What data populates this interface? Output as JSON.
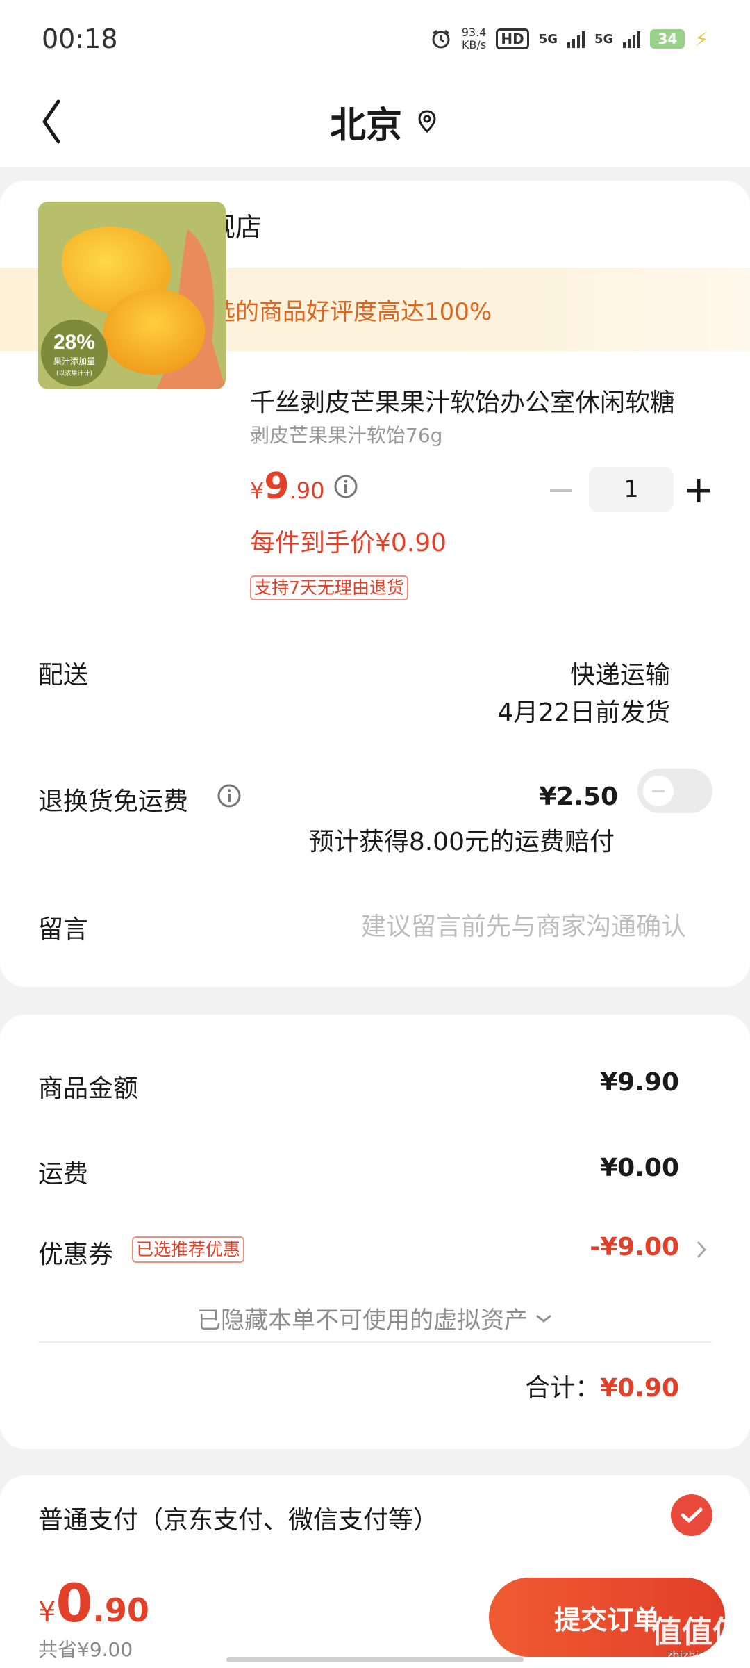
{
  "status_bar": {
    "time": "00:18",
    "net_speed": "93.4",
    "net_unit": "KB/s",
    "hd": "HD",
    "sig1": "5G",
    "sig2": "5G",
    "battery": "34",
    "icons": [
      "alarm-icon",
      "hd-icon",
      "signal-icon",
      "battery-icon",
      "charging-icon"
    ]
  },
  "nav": {
    "title": "北京"
  },
  "store": {
    "name": "千丝食品旗舰店"
  },
  "banner": {
    "text": "恭喜你，挑选的商品好评度高达100%"
  },
  "product": {
    "title": "千丝剥皮芒果果汁软饴办公室休闲软糖",
    "spec": "剥皮芒果果汁软饴76g",
    "price_currency": "¥",
    "price_int": "9",
    "price_dec": ".90",
    "unit_price": "每件到手价¥0.90",
    "return_tag": "支持7天无理由退货",
    "quantity": "1",
    "image_badge_percent": "28%",
    "image_badge_line1": "果汁添加量",
    "image_badge_line2": "(以浓果汁计)"
  },
  "delivery": {
    "label": "配送",
    "method": "快递运输",
    "ship_date": "4月22日前发货"
  },
  "return_insurance": {
    "label": "退换货免运费",
    "price": "¥2.50",
    "note": "预计获得8.00元的运费赔付",
    "enabled": false
  },
  "message": {
    "label": "留言",
    "placeholder": "建议留言前先与商家沟通确认"
  },
  "summary": {
    "goods_label": "商品金额",
    "goods_value": "¥9.90",
    "shipping_label": "运费",
    "shipping_value": "¥0.00",
    "coupon_label": "优惠券",
    "coupon_tag": "已选推荐优惠",
    "coupon_value": "-¥9.00",
    "hidden_assets": "已隐藏本单不可使用的虚拟资产",
    "total_label": "合计：",
    "total_value": "¥0.90"
  },
  "payment": {
    "label": "普通支付（京东支付、微信支付等）",
    "selected": true
  },
  "bottom": {
    "currency": "¥",
    "int": "0",
    "dec": ".90",
    "saved": "共省¥9.00",
    "submit": "提交订单"
  },
  "watermark": {
    "text": "值值值",
    "sub": "zhizhizhi.com"
  },
  "colors": {
    "accent": "#e3402a",
    "banner_text": "#e0651f",
    "banner_bg": "#fdf2d8"
  }
}
